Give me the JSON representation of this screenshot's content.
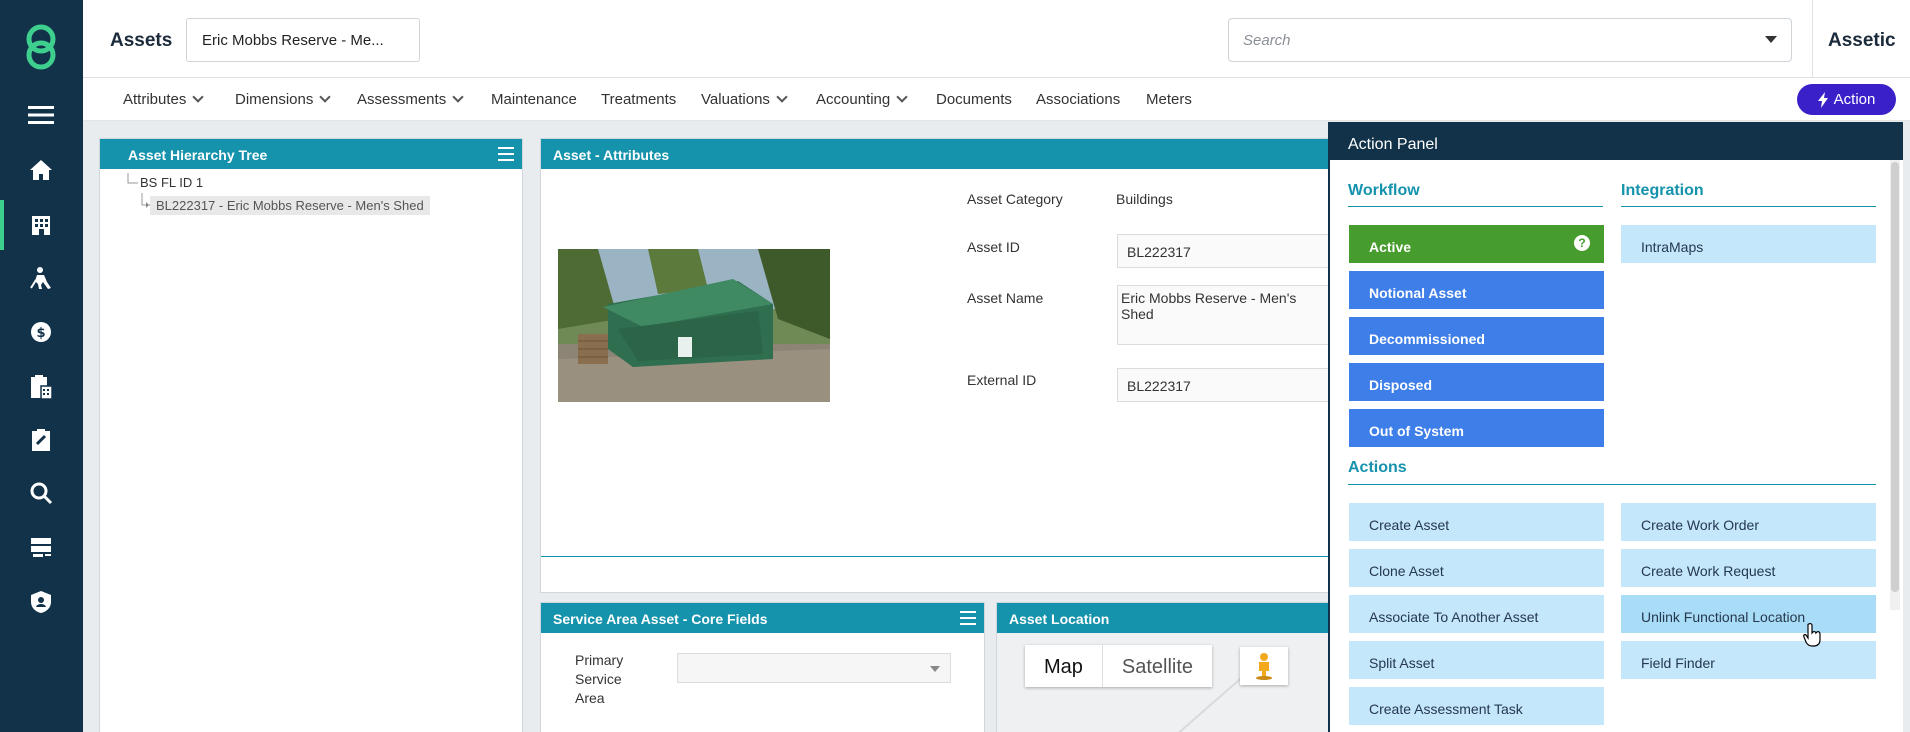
{
  "rail": {
    "icons": [
      "menu-icon",
      "home-icon",
      "building-icon",
      "worker-icon",
      "finance-icon",
      "clipboard-calc-icon",
      "assessment-icon",
      "search-icon",
      "server-icon",
      "shield-user-icon"
    ]
  },
  "header": {
    "title": "Assets",
    "asset_select": "Eric Mobbs Reserve - Me...",
    "search_placeholder": "Search",
    "brand": "Assetic"
  },
  "nav": {
    "items": [
      {
        "label": "Attributes",
        "dropdown": true
      },
      {
        "label": "Dimensions",
        "dropdown": true
      },
      {
        "label": "Assessments",
        "dropdown": true
      },
      {
        "label": "Maintenance",
        "dropdown": false
      },
      {
        "label": "Treatments",
        "dropdown": false
      },
      {
        "label": "Valuations",
        "dropdown": true
      },
      {
        "label": "Accounting",
        "dropdown": true
      },
      {
        "label": "Documents",
        "dropdown": false
      },
      {
        "label": "Associations",
        "dropdown": false
      },
      {
        "label": "Meters",
        "dropdown": false
      }
    ],
    "action_label": "Action"
  },
  "tree_panel": {
    "title": "Asset Hierarchy Tree",
    "root": "BS FL ID 1",
    "child": "BL222317 - Eric Mobbs Reserve - Men's Shed"
  },
  "attributes_panel": {
    "title": "Asset - Attributes",
    "category_label": "Asset Category",
    "category_value": "Buildings",
    "asset_id_label": "Asset ID",
    "asset_id_value": "BL222317",
    "asset_name_label": "Asset Name",
    "asset_name_value": "Eric Mobbs Reserve - Men's Shed",
    "external_id_label": "External ID",
    "external_id_value": "BL222317"
  },
  "service_panel": {
    "title": "Service Area Asset - Core Fields",
    "primary_label_1": "Primary",
    "primary_label_2": "Service",
    "primary_label_3": "Area"
  },
  "location_panel": {
    "title": "Asset Location",
    "map_label": "Map",
    "satellite_label": "Satellite"
  },
  "action_panel": {
    "title": "Action Panel",
    "workflow_heading": "Workflow",
    "integration_heading": "Integration",
    "actions_heading": "Actions",
    "workflow": [
      "Active",
      "Notional Asset",
      "Decommissioned",
      "Disposed",
      "Out of System"
    ],
    "integration": [
      "IntraMaps"
    ],
    "actions_left": [
      "Create Asset",
      "Clone Asset",
      "Associate To Another Asset",
      "Split Asset",
      "Create Assessment Task"
    ],
    "actions_right": [
      "Create Work Order",
      "Create Work Request",
      "Unlink Functional Location",
      "Field Finder"
    ],
    "help_symbol": "?"
  },
  "colors": {
    "rail": "#12324a",
    "teal": "#1592ac",
    "active_green": "#479c2e",
    "workflow_blue": "#3d7ee8",
    "action_light": "#c4e7fb",
    "action_button": "#3a20c9"
  }
}
